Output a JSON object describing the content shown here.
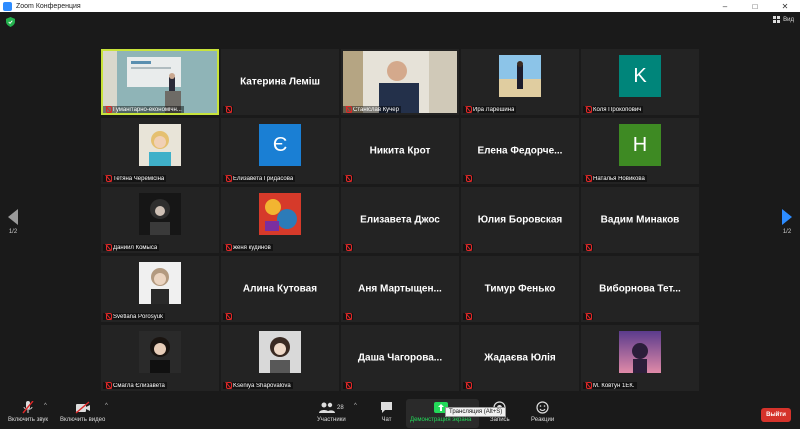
{
  "window": {
    "title": "Zoom Конференция",
    "minimize": "–",
    "maximize": "□",
    "close": "✕"
  },
  "top_right": {
    "view_label": "Вид"
  },
  "paging": {
    "left": "1/2",
    "right": "1/2"
  },
  "tiles": [
    {
      "kind": "video",
      "label": "Гуманітарно-економічн...",
      "active": true
    },
    {
      "kind": "name",
      "name": "Катерина Леміш",
      "label": ""
    },
    {
      "kind": "video2",
      "label": "Станіслав Кучер"
    },
    {
      "kind": "photo",
      "photo": "beach",
      "label": "Ира Ларешина"
    },
    {
      "kind": "avatar",
      "letter": "K",
      "color": "#00857a",
      "label": "Коля Прокопович"
    },
    {
      "kind": "photo",
      "photo": "blonde",
      "label": "Тетяна Черемісіна"
    },
    {
      "kind": "avatar",
      "letter": "Є",
      "color": "#1a7fd4",
      "label": "Елизавета Гридасова"
    },
    {
      "kind": "name",
      "name": "Никита Крот",
      "label": ""
    },
    {
      "kind": "name",
      "name": "Елена  Федорче...",
      "label": ""
    },
    {
      "kind": "avatar",
      "letter": "H",
      "color": "#3e8a23",
      "label": "Наталья Новикова"
    },
    {
      "kind": "photo",
      "photo": "dark",
      "label": "Даниил Комыса"
    },
    {
      "kind": "photo",
      "photo": "colorful",
      "label": "женя кудинов"
    },
    {
      "kind": "name",
      "name": "Елизавета Джос",
      "label": ""
    },
    {
      "kind": "name",
      "name": "Юлия Боровская",
      "label": ""
    },
    {
      "kind": "name",
      "name": "Вадим Минаков",
      "label": ""
    },
    {
      "kind": "photo",
      "photo": "portrait",
      "label": "Svetlana Porosyuk"
    },
    {
      "kind": "name",
      "name": "Алина Кутовая",
      "label": ""
    },
    {
      "kind": "name",
      "name": "Аня  Мартыщен...",
      "label": ""
    },
    {
      "kind": "name",
      "name": "Тимур Фенько",
      "label": ""
    },
    {
      "kind": "name",
      "name": "Виборнова  Тет...",
      "label": ""
    },
    {
      "kind": "photo",
      "photo": "girl",
      "label": "Смагла  Єлизавета"
    },
    {
      "kind": "photo",
      "photo": "girl2",
      "label": "Kseniya Shapovalova"
    },
    {
      "kind": "name",
      "name": "Даша  Чагорова...",
      "label": ""
    },
    {
      "kind": "name",
      "name": "Жадаєва Юлія",
      "label": ""
    },
    {
      "kind": "photo",
      "photo": "sunset",
      "label": "М. Ковтун 1ЕК."
    }
  ],
  "toolbar": {
    "audio": "Включить звук",
    "video": "Включить видео",
    "participants": "Участники",
    "participants_count": "28",
    "chat": "Чат",
    "share": "Демонстрация экрана",
    "record": "Запись",
    "reactions": "Реакции",
    "leave": "Выйти",
    "tooltip": "Трансляция (Alt+S)",
    "caret": "^"
  },
  "colors": {
    "active_border": "#c8e33b",
    "share_green": "#23d959",
    "leave_red": "#d5332b",
    "accent_blue": "#2d8cff"
  }
}
